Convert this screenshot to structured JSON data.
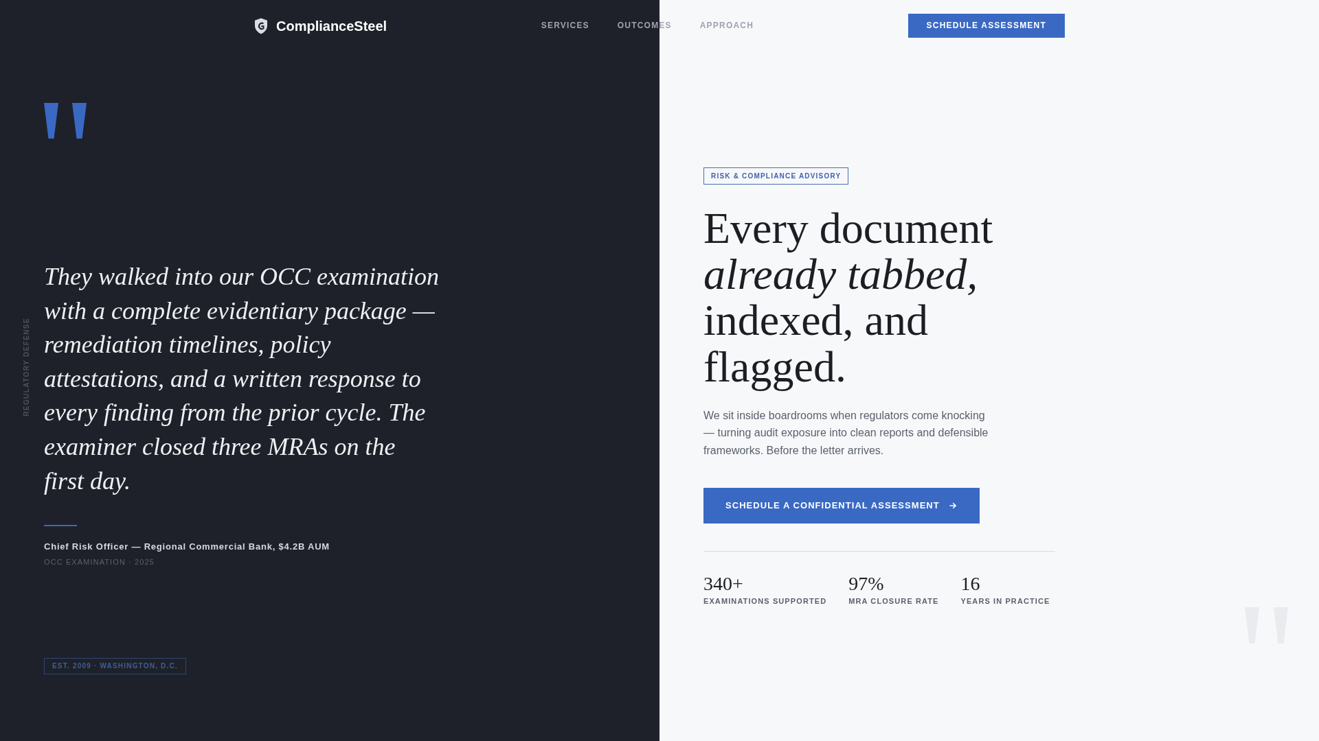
{
  "nav": {
    "brand": "ComplianceSteel",
    "links": [
      {
        "label": "SERVICES"
      },
      {
        "label": "OUTCOMES"
      },
      {
        "label": "APPROACH"
      }
    ],
    "cta": "SCHEDULE ASSESSMENT"
  },
  "testimonial": {
    "side_label": "REGULATORY DEFENSE",
    "quote": "They walked into our OCC examination with a complete evidentiary package — remediation timelines, policy attestations, and a written response to every finding from the prior cycle. The examiner closed three MRAs on the first day.",
    "attribution": "Chief Risk Officer — Regional Commercial Bank, $4.2B AUM",
    "context": "OCC EXAMINATION · 2025",
    "badge": "EST. 2009 · WASHINGTON, D.C."
  },
  "hero": {
    "tag": "RISK & COMPLIANCE ADVISORY",
    "headline": "Every document *already tabbed,* indexed, and flagged.",
    "lede": "We sit inside boardrooms when regulators come knocking — turning audit exposure into clean reports and defensible frameworks. Before the letter arrives.",
    "cta": "SCHEDULE A CONFIDENTIAL ASSESSMENT",
    "stats": [
      {
        "value": "340+",
        "label": "EXAMINATIONS SUPPORTED"
      },
      {
        "value": "97%",
        "label": "MRA CLOSURE RATE"
      },
      {
        "value": "16",
        "label": "YEARS IN PRACTICE"
      }
    ]
  }
}
